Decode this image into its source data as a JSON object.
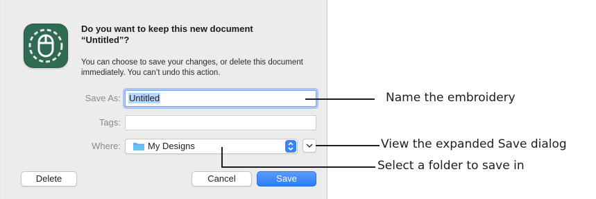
{
  "dialog": {
    "title": "Do you want to keep this new document “Untitled”?",
    "message": "You can choose to save your changes, or delete this document immediately. You can’t undo this action.",
    "save_as": {
      "label": "Save As:",
      "value": "Untitled"
    },
    "tags": {
      "label": "Tags:",
      "value": ""
    },
    "where": {
      "label": "Where:",
      "value": "My Designs"
    },
    "buttons": {
      "delete": "Delete",
      "cancel": "Cancel",
      "save": "Save"
    }
  },
  "callouts": {
    "name": "Name the embroidery",
    "expand": "View the expanded Save dialog",
    "folder": "Select a folder to save in"
  },
  "colors": {
    "accent": "#3b82f7",
    "app_icon": "#2f6a52",
    "folder": "#5ab1ea"
  },
  "icons": {
    "app": "mouse-icon",
    "folder": "folder-icon",
    "stepper": "updown-chevron-icon",
    "expand": "chevron-down-icon"
  }
}
